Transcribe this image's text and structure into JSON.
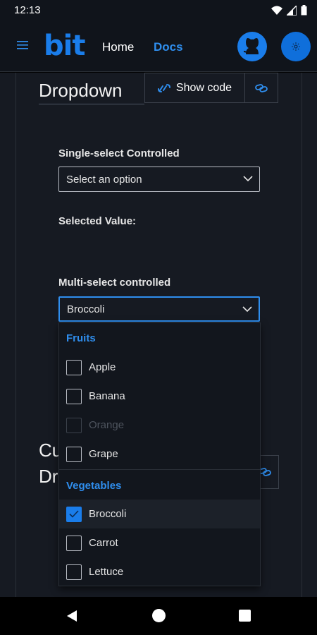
{
  "status": {
    "time": "12:13"
  },
  "header": {
    "logo": "bit",
    "nav_home": "Home",
    "nav_docs": "Docs"
  },
  "section": {
    "title": "Dropdown",
    "show_code": "Show code"
  },
  "single": {
    "label": "Single-select Controlled",
    "placeholder": "Select an option",
    "selected_value_label": "Selected Value:"
  },
  "multi": {
    "label": "Multi-select controlled",
    "value": "Broccoli",
    "groups": [
      {
        "header": "Fruits",
        "options": [
          {
            "label": "Apple",
            "checked": false,
            "disabled": false
          },
          {
            "label": "Banana",
            "checked": false,
            "disabled": false
          },
          {
            "label": "Orange",
            "checked": false,
            "disabled": true
          },
          {
            "label": "Grape",
            "checked": false,
            "disabled": false
          }
        ]
      },
      {
        "header": "Vegetables",
        "options": [
          {
            "label": "Broccoli",
            "checked": true,
            "disabled": false
          },
          {
            "label": "Carrot",
            "checked": false,
            "disabled": false
          },
          {
            "label": "Lettuce",
            "checked": false,
            "disabled": false
          }
        ]
      }
    ]
  },
  "next_section": {
    "line1": "Cu",
    "line2": "Dr"
  },
  "colors": {
    "accent": "#1a7dea",
    "background": "#161a22",
    "app_bar": "#10141b"
  }
}
